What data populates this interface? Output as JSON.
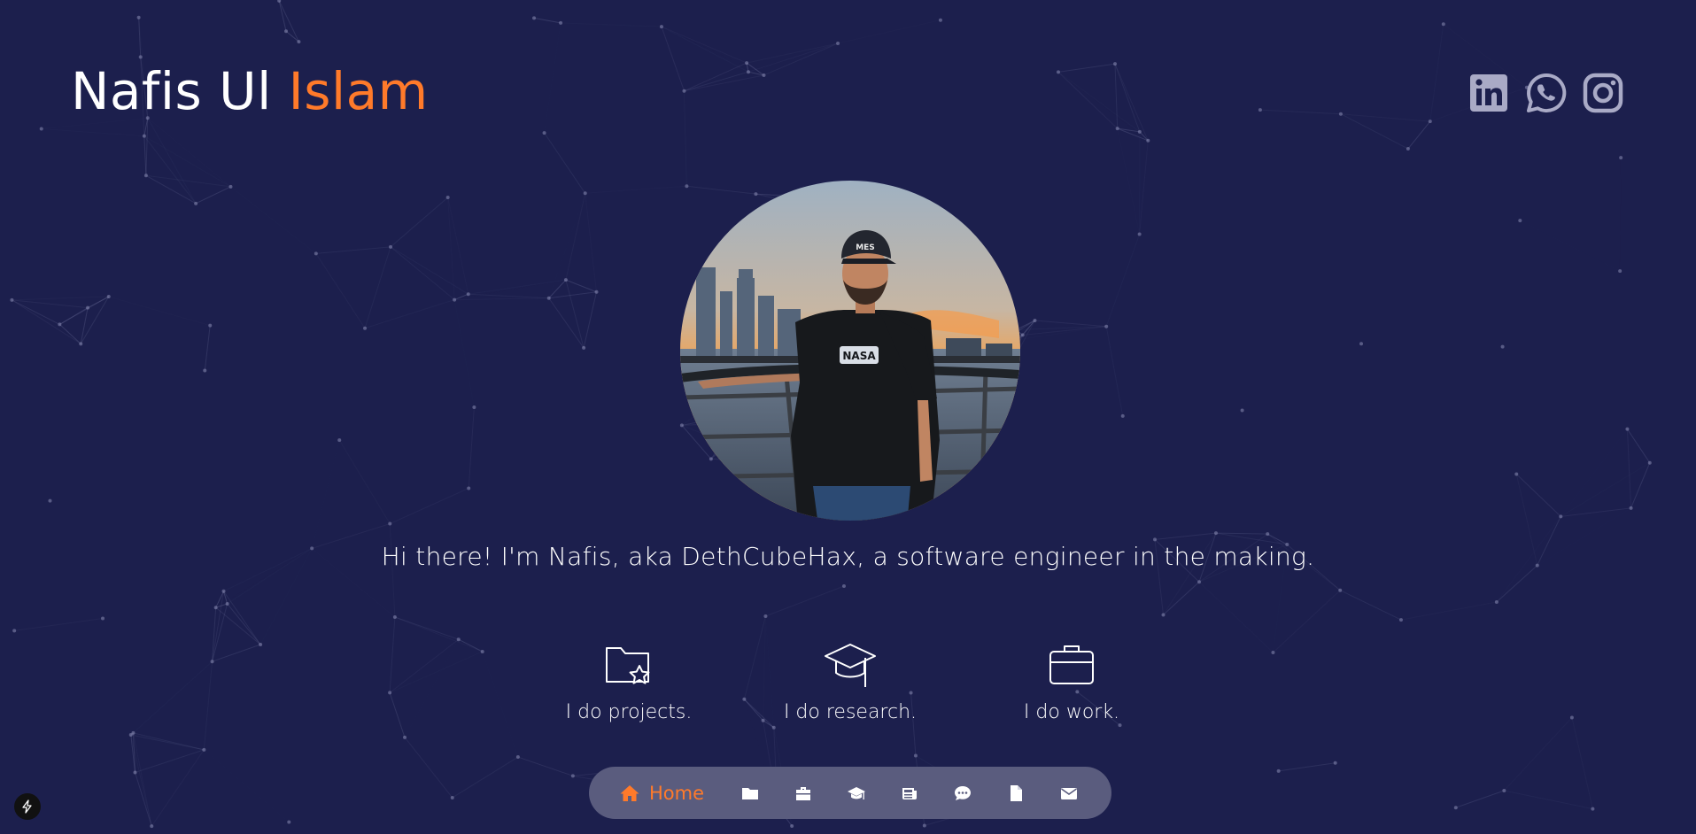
{
  "header": {
    "name_first": "Nafis Ul",
    "name_last": "Islam"
  },
  "social": [
    {
      "icon": "linkedin-icon"
    },
    {
      "icon": "whatsapp-icon"
    },
    {
      "icon": "instagram-icon"
    }
  ],
  "hero": {
    "intro": "Hi there! I'm Nafis, aka DethCubeHax, a software engineer in the making.",
    "photo_text": {
      "cap": "MES",
      "shirt": "NASA"
    }
  },
  "features": [
    {
      "icon": "folder-star-icon",
      "label": "I do projects."
    },
    {
      "icon": "graduation-cap-icon",
      "label": "I do research."
    },
    {
      "icon": "briefcase-icon",
      "label": "I do work."
    }
  ],
  "nav": {
    "active_label": "Home",
    "items": [
      "home-icon",
      "folder-icon",
      "briefcase-icon",
      "graduation-cap-icon",
      "newspaper-icon",
      "comment-icon",
      "file-icon",
      "envelope-icon"
    ]
  },
  "colors": {
    "background": "#1c1f4d",
    "accent": "#ff7a2a",
    "nav_bar": "#5a5c7e",
    "social_icon": "#a9aac6"
  }
}
